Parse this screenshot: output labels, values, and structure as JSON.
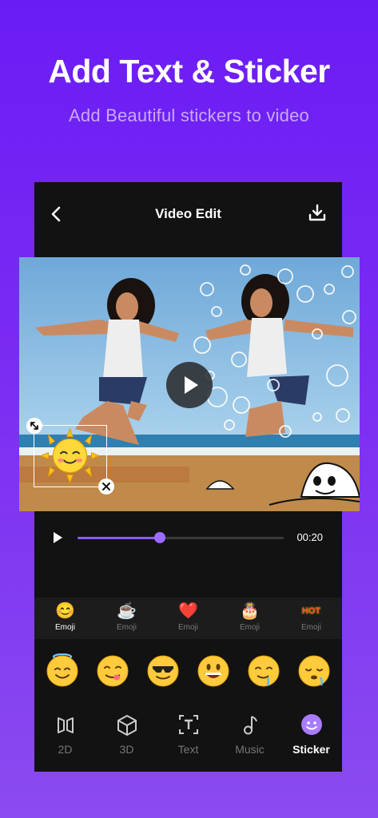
{
  "hero": {
    "title": "Add Text & Sticker",
    "subtitle": "Add Beautiful stickers to video"
  },
  "header": {
    "title": "Video Edit",
    "back_icon": "chevron-left-icon",
    "download_icon": "download-icon"
  },
  "player": {
    "time": "00:20",
    "progress": 0.4
  },
  "categories": [
    {
      "label": "Emoji",
      "icon": "😊",
      "active": true
    },
    {
      "label": "Emoji",
      "icon": "☕",
      "active": false
    },
    {
      "label": "Emoji",
      "icon": "❤️",
      "active": false
    },
    {
      "label": "Emoji",
      "icon": "🎂",
      "active": false
    },
    {
      "label": "Emoji",
      "icon": "HOT",
      "active": false
    }
  ],
  "emojis": [
    {
      "name": "halo-face"
    },
    {
      "name": "yum-face"
    },
    {
      "name": "sunglasses-face"
    },
    {
      "name": "grin-face"
    },
    {
      "name": "drool-face"
    },
    {
      "name": "sleepy-face"
    }
  ],
  "toolbar": [
    {
      "label": "2D",
      "icon": "2d-icon",
      "active": false
    },
    {
      "label": "3D",
      "icon": "3d-cube-icon",
      "active": false
    },
    {
      "label": "Text",
      "icon": "text-icon",
      "active": false
    },
    {
      "label": "Music",
      "icon": "music-note-icon",
      "active": false
    },
    {
      "label": "Sticker",
      "icon": "sticker-icon",
      "active": true
    }
  ],
  "colors": {
    "accent": "#8b5cf6",
    "background_top": "#6a1cf5",
    "background_bottom": "#8a4bf0",
    "panel": "#121212"
  }
}
